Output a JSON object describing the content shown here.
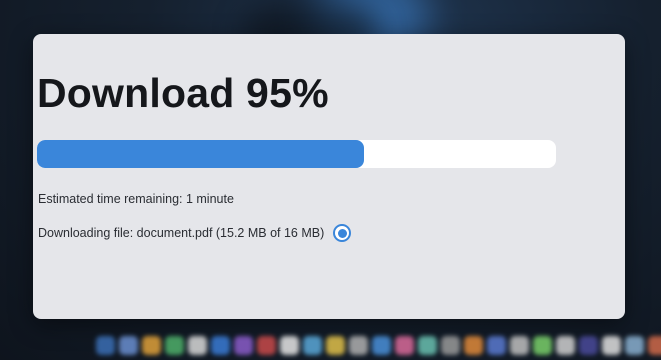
{
  "window": {
    "title": "Download 95%"
  },
  "progress": {
    "percent": 95,
    "displayed_fill_fraction": 0.63,
    "fill_color": "#3a86da",
    "track_color": "#ffffff"
  },
  "status": {
    "eta_text": "Estimated time remaining: 1 minute",
    "file_text": "Downloading file: document.pdf (15.2 MB of 16 MB)"
  },
  "icons": {
    "activity": "progress-indicator-icon"
  },
  "dock": {
    "colors": [
      "#3b6fb5",
      "#6a8fd0",
      "#e0a13a",
      "#4fb06a",
      "#d9d9d9",
      "#3a7bd5",
      "#8a5cc9",
      "#c94a4a",
      "#e6e6e6",
      "#5aa8d8",
      "#e0c04a",
      "#b0b0b0",
      "#4a90d9",
      "#d96a9a",
      "#6ac0b0",
      "#9a9a9a",
      "#e08a3a",
      "#5a7ad0",
      "#c0c0c0",
      "#7ad06a",
      "#d0d0d0",
      "#4a4a9a",
      "#e0e0e0",
      "#8ab0d0",
      "#d06a4a",
      "#a0a0a0"
    ]
  }
}
